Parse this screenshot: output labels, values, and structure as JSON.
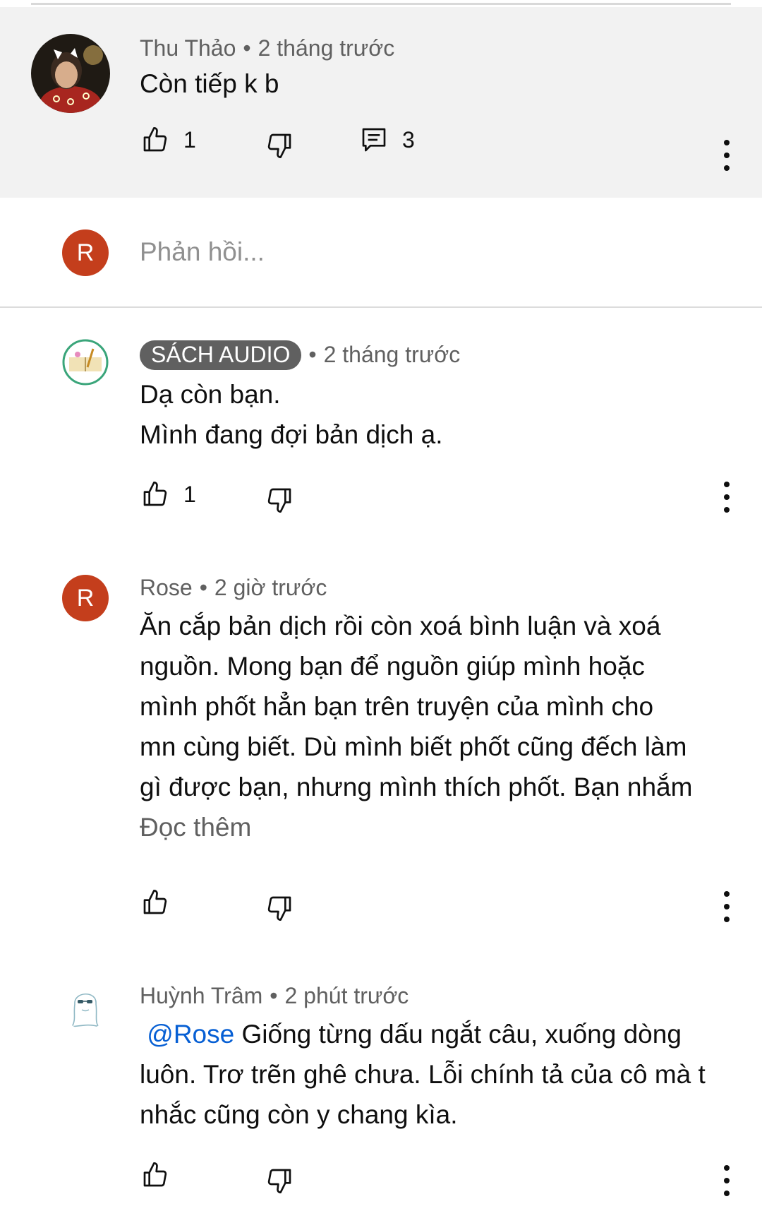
{
  "parent": {
    "author": "Thu Thảo",
    "time": "2 tháng trước",
    "text": "Còn tiếp k b",
    "likes": "1",
    "replies": "3"
  },
  "reply_box": {
    "avatar_letter": "R",
    "placeholder": "Phản hồi..."
  },
  "comments": [
    {
      "author": "SÁCH AUDIO",
      "time": "2 tháng trước",
      "line1": "Dạ còn bạn.",
      "line2": "Mình đang đợi bản dịch ạ.",
      "likes": "1"
    },
    {
      "author": "Rose",
      "avatar_letter": "R",
      "time": "2 giờ trước",
      "lines": [
        "Ăn cắp bản dịch rồi còn xoá bình luận và xoá",
        "nguồn. Mong bạn để nguồn giúp mình hoặc",
        "mình phốt hẳn bạn trên truyện của mình cho",
        "mn cùng biết. Dù mình biết phốt cũng đếch làm",
        "gì được bạn, nhưng mình thích phốt. Bạn nhắm"
      ],
      "read_more": "Đọc thêm"
    },
    {
      "author": "Huỳnh Trâm",
      "time": "2 phút trước",
      "mention": "@Rose",
      "line1_rest": " Giống từng dấu ngắt câu, xuống dòng",
      "line2": "luôn. Trơ trẽn ghê chưa. Lỗi chính tả của cô mà t",
      "line3": "nhắc cũng còn y chang kìa."
    }
  ],
  "colors": {
    "highlight_bg": "#f2f2f2",
    "avatar_letter_bg": "#c43e1c",
    "mention": "#065fd4",
    "meta": "#606060"
  }
}
